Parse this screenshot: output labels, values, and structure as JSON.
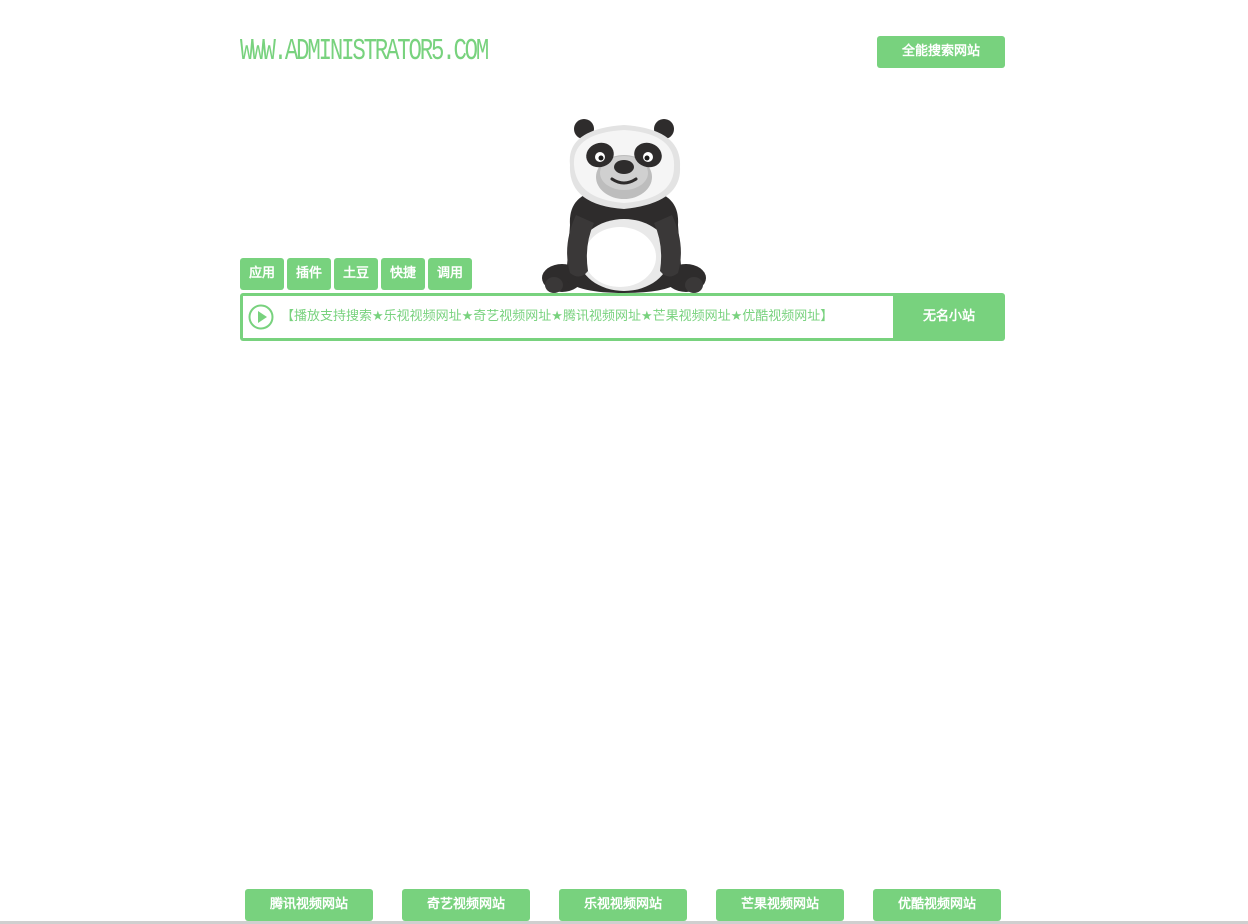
{
  "header": {
    "logo_text": "WWW.ADMINISTRATOR5.COM",
    "top_button_label": "全能搜索网站"
  },
  "mascot": {
    "icon": "panda-mascot"
  },
  "tabs": [
    {
      "label": "应用"
    },
    {
      "label": "插件"
    },
    {
      "label": "土豆"
    },
    {
      "label": "快捷"
    },
    {
      "label": "调用"
    }
  ],
  "search": {
    "text": "【播放支持搜索★乐视视频网址★奇艺视频网址★腾讯视频网址★芒果视频网址★优酷视频网址】",
    "button_label": "无名小站",
    "icon": "play-circle-icon"
  },
  "bottom_nav": [
    {
      "label": "腾讯视频网站"
    },
    {
      "label": "奇艺视频网站"
    },
    {
      "label": "乐视视频网站"
    },
    {
      "label": "芒果视频网站"
    },
    {
      "label": "优酷视频网站"
    }
  ],
  "colors": {
    "accent": "#78d27e",
    "text_on_accent": "#ffffff",
    "background": "#ffffff"
  }
}
